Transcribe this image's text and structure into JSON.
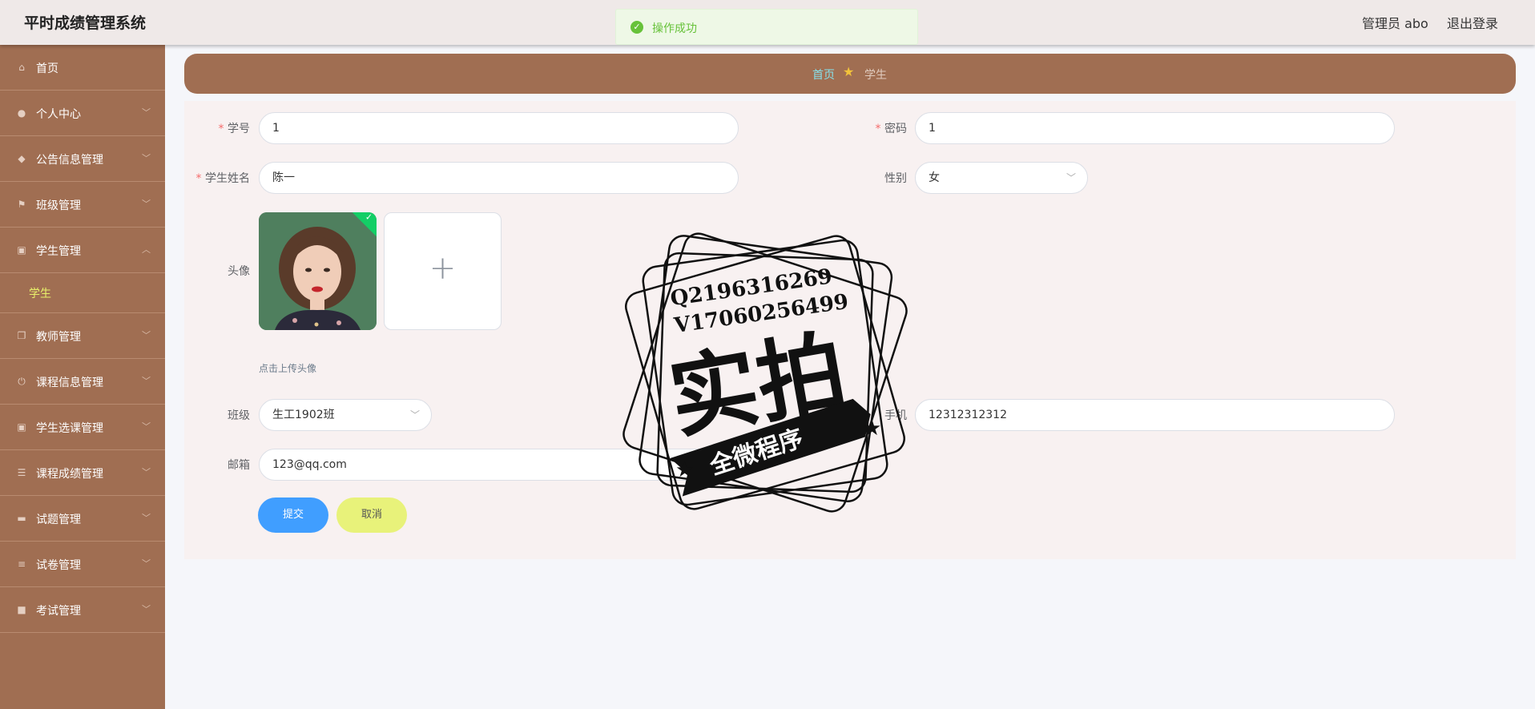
{
  "header": {
    "title": "平时成绩管理系统",
    "user_role": "管理员 abo",
    "logout": "退出登录"
  },
  "toast": {
    "message": "操作成功",
    "icon": "success-check-icon",
    "color": "#67c23a"
  },
  "sidebar": {
    "items": [
      {
        "label": "首页",
        "icon": "home-icon"
      },
      {
        "label": "个人中心",
        "icon": "user-icon"
      },
      {
        "label": "公告信息管理",
        "icon": "bell-icon"
      },
      {
        "label": "班级管理",
        "icon": "flag-icon"
      },
      {
        "label": "学生管理",
        "icon": "clipboard-icon",
        "expanded": true,
        "children": [
          "学生"
        ]
      },
      {
        "label": "教师管理",
        "icon": "copy-icon"
      },
      {
        "label": "课程信息管理",
        "icon": "power-icon"
      },
      {
        "label": "学生选课管理",
        "icon": "clipboard-icon"
      },
      {
        "label": "课程成绩管理",
        "icon": "list-icon"
      },
      {
        "label": "试题管理",
        "icon": "monitor-icon"
      },
      {
        "label": "试卷管理",
        "icon": "sliders-icon"
      },
      {
        "label": "考试管理",
        "icon": "briefcase-icon"
      }
    ],
    "active_child": "学生",
    "bg_color": "#a06e52"
  },
  "breadcrumb": {
    "home": "首页",
    "current": "学生"
  },
  "form": {
    "student_id": {
      "label": "学号",
      "value": "1",
      "required": true
    },
    "password": {
      "label": "密码",
      "value": "1",
      "required": true
    },
    "student_name": {
      "label": "学生姓名",
      "value": "陈一",
      "required": true
    },
    "gender": {
      "label": "性别",
      "value": "女"
    },
    "avatar": {
      "label": "头像",
      "upload_tip": "点击上传头像",
      "upload_symbol": "+"
    },
    "class": {
      "label": "班级",
      "value": "生工1902班"
    },
    "phone": {
      "label": "手机",
      "value": "12312312312"
    },
    "email": {
      "label": "邮箱",
      "value": "123@qq.com"
    },
    "submit_label": "提交",
    "cancel_label": "取消"
  },
  "watermark": {
    "line1": "Q2196316269",
    "line2": "V17060256499",
    "big_text": "实拍",
    "ribbon_text": "全微程序"
  }
}
